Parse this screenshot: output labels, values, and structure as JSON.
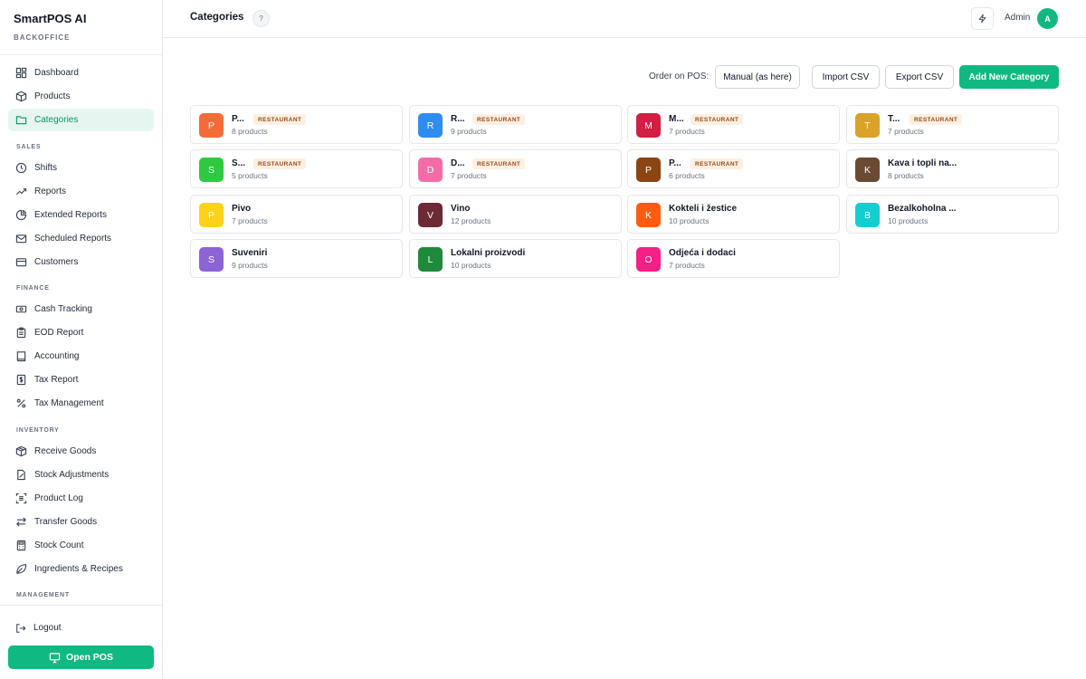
{
  "app": {
    "name": "SmartPOS AI",
    "subtitle": "BACKOFFICE"
  },
  "sidebar": {
    "items": [
      {
        "label": "Dashboard",
        "icon": "dashboard-icon"
      },
      {
        "label": "Products",
        "icon": "box-icon"
      },
      {
        "label": "Categories",
        "icon": "folder-icon",
        "active": true
      },
      {
        "label": "Shifts",
        "icon": "clock-icon"
      },
      {
        "label": "Reports",
        "icon": "trend-icon"
      },
      {
        "label": "Extended Reports",
        "icon": "pie-chart-icon"
      },
      {
        "label": "Scheduled Reports",
        "icon": "mail-icon"
      },
      {
        "label": "Customers",
        "icon": "card-icon"
      },
      {
        "label": "Cash Tracking",
        "icon": "cash-icon"
      },
      {
        "label": "EOD Report",
        "icon": "clipboard-icon"
      },
      {
        "label": "Accounting",
        "icon": "book-icon"
      },
      {
        "label": "Tax Report",
        "icon": "dollar-doc-icon"
      },
      {
        "label": "Tax Management",
        "icon": "percent-icon"
      },
      {
        "label": "Receive Goods",
        "icon": "package-icon"
      },
      {
        "label": "Stock Adjustments",
        "icon": "edit-doc-icon"
      },
      {
        "label": "Product Log",
        "icon": "scan-icon"
      },
      {
        "label": "Transfer Goods",
        "icon": "arrows-icon"
      },
      {
        "label": "Stock Count",
        "icon": "calculator-icon"
      },
      {
        "label": "Ingredients & Recipes",
        "icon": "leaf-icon"
      }
    ],
    "sections": {
      "sales": "SALES",
      "finance": "FINANCE",
      "inventory": "INVENTORY",
      "management": "MANAGEMENT"
    },
    "logout": "Logout",
    "open_pos": "Open POS"
  },
  "header": {
    "title": "Categories",
    "help": "?",
    "user": "Admin",
    "avatar_initial": "A"
  },
  "toolbar": {
    "order_label": "Order on POS:",
    "order_value": "Manual (as here)",
    "import": "Import CSV",
    "export": "Export CSV",
    "add": "Add New Category"
  },
  "categories": [
    {
      "initial": "P",
      "name": "P...",
      "count": "8 products",
      "badge": "RESTAURANT",
      "color": "#f26c3a"
    },
    {
      "initial": "R",
      "name": "R...",
      "count": "9 products",
      "badge": "RESTAURANT",
      "color": "#2f8df0"
    },
    {
      "initial": "M",
      "name": "M...",
      "count": "7 products",
      "badge": "RESTAURANT",
      "color": "#d21f42"
    },
    {
      "initial": "T",
      "name": "T...",
      "count": "7 products",
      "badge": "RESTAURANT",
      "color": "#d9a22a"
    },
    {
      "initial": "S",
      "name": "S...",
      "count": "5 products",
      "badge": "RESTAURANT",
      "color": "#2ec940"
    },
    {
      "initial": "D",
      "name": "D...",
      "count": "7 products",
      "badge": "RESTAURANT",
      "color": "#f46ca7"
    },
    {
      "initial": "P",
      "name": "P...",
      "count": "6 products",
      "badge": "RESTAURANT",
      "color": "#8a4513"
    },
    {
      "initial": "K",
      "name": "Kava i topli na...",
      "count": "8 products",
      "badge": "",
      "color": "#6b4a34"
    },
    {
      "initial": "P",
      "name": "Pivo",
      "count": "7 products",
      "badge": "",
      "color": "#ffd21a"
    },
    {
      "initial": "V",
      "name": "Vino",
      "count": "12 products",
      "badge": "",
      "color": "#6c2a36"
    },
    {
      "initial": "K",
      "name": "Kokteli i žestice",
      "count": "10 products",
      "badge": "",
      "color": "#ff5a12"
    },
    {
      "initial": "B",
      "name": "Bezalkoholna ...",
      "count": "10 products",
      "badge": "",
      "color": "#14cdd0"
    },
    {
      "initial": "S",
      "name": "Suveniri",
      "count": "9 products",
      "badge": "",
      "color": "#8d63d6"
    },
    {
      "initial": "L",
      "name": "Lokalni proizvodi",
      "count": "10 products",
      "badge": "",
      "color": "#1f8a3a"
    },
    {
      "initial": "O",
      "name": "Odjeća i dodaci",
      "count": "7 products",
      "badge": "",
      "color": "#f51f86"
    }
  ]
}
